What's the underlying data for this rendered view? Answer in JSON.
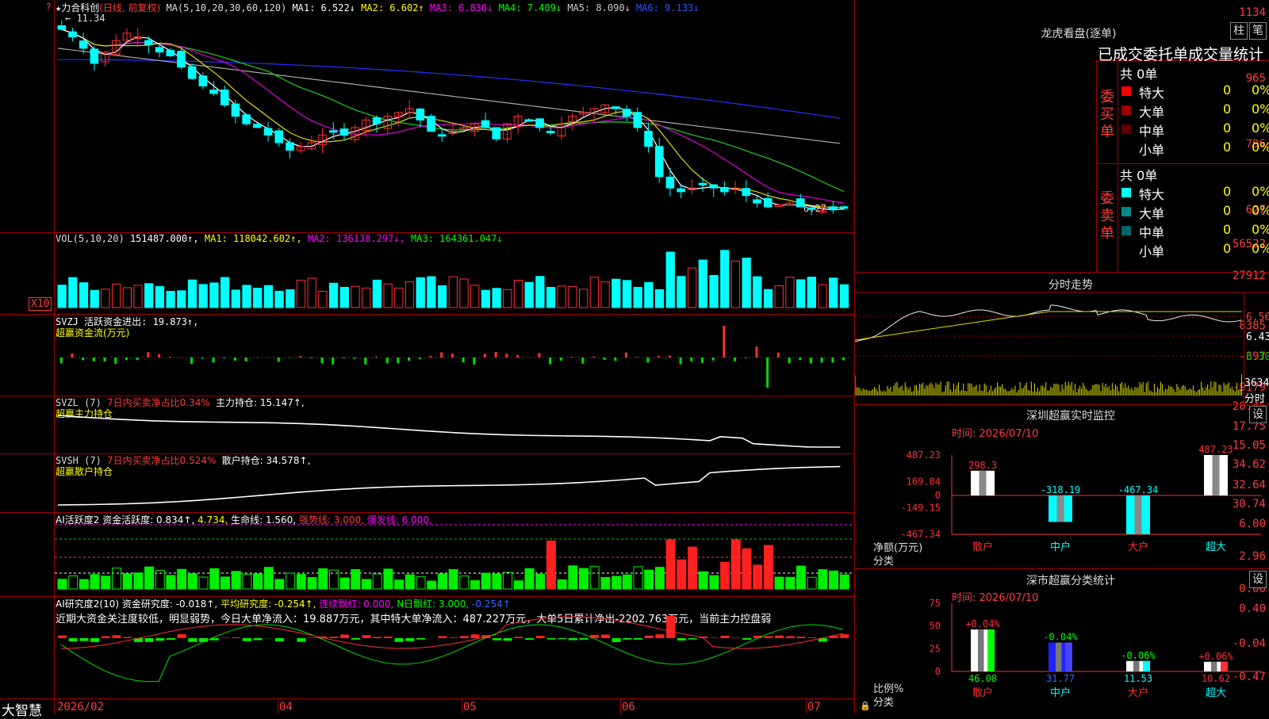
{
  "top_header": {
    "star": "★",
    "name": "力合科创",
    "kline_type": "(日线, 前复权)",
    "ma_def": "MA(5,10,20,30,60,120)",
    "ma1": "MA1: 6.522↓",
    "ma2": "MA2: 6.602↑",
    "ma3": "MA3: 6.836↓",
    "ma4": "MA4: 7.409↓",
    "ma5": "MA5: 8.090↓",
    "ma6": "MA6: 9.133↓",
    "max_label": "11.34",
    "min_label": "6.27"
  },
  "price_axis": [
    "1134",
    "965",
    "796",
    "627"
  ],
  "vol_panel": {
    "title": "VOL(5,10,20)",
    "value": "151487.000↑,",
    "ma1": "MA1: 118042.602↑,",
    "ma2": "MA2: 136138.297↓,",
    "ma3": "MA3: 164361.047↓",
    "axis": [
      "56522",
      "27912"
    ],
    "unit": "X10"
  },
  "svzj_panel": {
    "title": "SVZJ  活跃资金进出: 19.873↑,",
    "subtitle": "超赢资金流(万元)",
    "axis": [
      "8385",
      "-397",
      "-9179"
    ]
  },
  "svzl_panel": {
    "title": "SVZL (7)",
    "ratio": "7日内买卖净占比0.34%",
    "main": "主力持仓: 15.147↑,",
    "subtitle": "超赢主力持仓",
    "axis": [
      "20.45",
      "17.75",
      "15.05"
    ]
  },
  "svsh_panel": {
    "title": "SVSH (7)",
    "ratio": "7日内买卖净占比0.524%",
    "retail": "散户持仓: 34.578↑,",
    "subtitle": "超赢散户持仓",
    "axis": [
      "34.62",
      "32.64",
      "30.74"
    ]
  },
  "ai_active": {
    "title": "AI活跃度2 资金活跃度: 0.834↑,",
    "v2": "4.734,",
    "life": "生命线: 1.560,",
    "strong": "强势线: 3.000,",
    "burst": "爆发线: 6.000,",
    "axis": [
      "6.00",
      "2.96",
      "0.00"
    ]
  },
  "ai_research": {
    "title": "AI研究度2(10) 资金研究度: -0.018↑,",
    "avg": "平均研究度: -0.254↑,",
    "streak": "连续飘红: 0.000,",
    "nday": "N日飘红: 3.000,",
    "last": "-0.254↑",
    "comment": "近期大资金关注度较低，明显弱势，今日大单净流入：19.887万元，其中特大单净流入：487.227万元，大单5日累计净出-2202.763万元，当前主力控盘弱",
    "axis": [
      "0.40",
      "-0.04",
      "-0.47"
    ]
  },
  "date_axis": {
    "brand": "大智慧",
    "labels": [
      "2026/02",
      "04",
      "05",
      "06",
      "07"
    ]
  },
  "dragon": {
    "title": "龙虎看盘(逐单)",
    "btn1": "柱",
    "btn2": "笔",
    "subtitle": "已成交委托单成交量统计",
    "buy_label": "委买单",
    "sell_label": "委卖单",
    "buy_total": "共 0单",
    "sell_total": "共 0单",
    "buy_rows": [
      {
        "name": "特大",
        "count": "0",
        "pct": "0%",
        "color": "#ff0000"
      },
      {
        "name": "大单",
        "count": "0",
        "pct": "0%",
        "color": "#a00000"
      },
      {
        "name": "中单",
        "count": "0",
        "pct": "0%",
        "color": "#600000"
      },
      {
        "name": "小单",
        "count": "0",
        "pct": "0%",
        "color": ""
      }
    ],
    "sell_rows": [
      {
        "name": "特大",
        "count": "0",
        "pct": "0%",
        "color": "#00ffff"
      },
      {
        "name": "大单",
        "count": "0",
        "pct": "0%",
        "color": "#008888"
      },
      {
        "name": "中单",
        "count": "0",
        "pct": "0%",
        "color": "#006666"
      },
      {
        "name": "小单",
        "count": "0",
        "pct": "0%",
        "color": ""
      }
    ]
  },
  "intraday": {
    "title": "分时走势",
    "axis": [
      "6.56",
      "6.43",
      "6.30"
    ],
    "vol_max": "3634",
    "unit": "分时"
  },
  "monitor": {
    "title": "深圳超赢实时监控",
    "btn": "设",
    "time": "时间: 2026/07/10",
    "axis": [
      "487.23",
      "169.04",
      "0",
      "-149.15",
      "-467.34"
    ],
    "ylabel": "净额(万元)",
    "xlabel": "分类",
    "bars": [
      {
        "name": "散户",
        "value": 298.3,
        "label": "298.3"
      },
      {
        "name": "中户",
        "value": -318.19,
        "label": "-318.19"
      },
      {
        "name": "大户",
        "value": -467.34,
        "label": "-467.34"
      },
      {
        "name": "超大",
        "value": 487.23,
        "label": "487.23"
      }
    ]
  },
  "classify": {
    "title": "深市超赢分类统计",
    "btn": "设",
    "time": "时间: 2026/07/10",
    "axis": [
      "75",
      "50",
      "25",
      "0"
    ],
    "ylabel": "比例%",
    "xlabel": "分类",
    "bars": [
      {
        "name": "散户",
        "value": 46.08,
        "delta": "+0.04%",
        "label": "46.08"
      },
      {
        "name": "中户",
        "value": 31.77,
        "delta": "-0.04%",
        "label": "31.77"
      },
      {
        "name": "大户",
        "value": 11.53,
        "delta": "-0.06%",
        "label": "11.53"
      },
      {
        "name": "超大",
        "value": 10.62,
        "delta": "+0.06%",
        "label": "10.62"
      }
    ]
  },
  "chart_data": {
    "type": "candlestick",
    "symbol": "力合科创",
    "closes": [
      11.1,
      10.9,
      10.6,
      10.2,
      10.5,
      10.8,
      11.0,
      10.9,
      10.7,
      10.5,
      10.4,
      10.1,
      9.8,
      9.6,
      9.4,
      9.1,
      8.8,
      8.6,
      8.5,
      8.3,
      8.1,
      7.9,
      8.0,
      8.1,
      8.3,
      8.4,
      8.3,
      8.5,
      8.7,
      8.6,
      8.8,
      8.9,
      9.0,
      8.7,
      8.4,
      8.3,
      8.4,
      8.5,
      8.6,
      8.5,
      8.2,
      8.6,
      8.8,
      8.7,
      8.5,
      8.4,
      8.6,
      8.8,
      8.9,
      9.0,
      9.1,
      9.0,
      8.8,
      8.5,
      8.0,
      7.2,
      6.9,
      6.8,
      6.9,
      7.0,
      6.9,
      6.8,
      6.9,
      6.7,
      6.5,
      6.4,
      6.45,
      6.5,
      6.4,
      6.35,
      6.3,
      6.32,
      6.4
    ]
  }
}
